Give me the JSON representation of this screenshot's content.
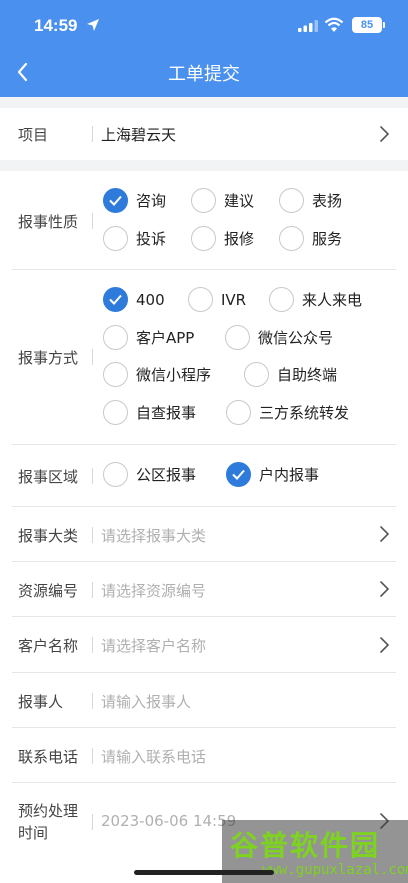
{
  "status_bar": {
    "time": "14:59",
    "battery": "85"
  },
  "nav": {
    "title": "工单提交"
  },
  "project": {
    "label": "项目",
    "value": "上海碧云天"
  },
  "nature": {
    "label": "报事性质",
    "options": [
      {
        "text": "咨询",
        "checked": true
      },
      {
        "text": "建议",
        "checked": false
      },
      {
        "text": "表扬",
        "checked": false
      },
      {
        "text": "投诉",
        "checked": false
      },
      {
        "text": "报修",
        "checked": false
      },
      {
        "text": "服务",
        "checked": false
      }
    ]
  },
  "method": {
    "label": "报事方式",
    "options": [
      {
        "text": "400",
        "checked": true
      },
      {
        "text": "IVR",
        "checked": false
      },
      {
        "text": "来人来电",
        "checked": false
      },
      {
        "text": "客户APP",
        "checked": false
      },
      {
        "text": "微信公众号",
        "checked": false
      },
      {
        "text": "微信小程序",
        "checked": false
      },
      {
        "text": "自助终端",
        "checked": false
      },
      {
        "text": "自查报事",
        "checked": false
      },
      {
        "text": "三方系统转发",
        "checked": false
      }
    ]
  },
  "area": {
    "label": "报事区域",
    "options": [
      {
        "text": "公区报事",
        "checked": false
      },
      {
        "text": "户内报事",
        "checked": true
      }
    ]
  },
  "category": {
    "label": "报事大类",
    "placeholder": "请选择报事大类"
  },
  "resource": {
    "label": "资源编号",
    "placeholder": "请选择资源编号"
  },
  "customer": {
    "label": "客户名称",
    "placeholder": "请选择客户名称"
  },
  "reporter": {
    "label": "报事人",
    "placeholder": "请输入报事人"
  },
  "phone": {
    "label": "联系电话",
    "placeholder": "请输入联系电话"
  },
  "appointment": {
    "label": "预约处理时间",
    "label_line1": "预约处理",
    "label_line2": "时间",
    "value": "2023-06-06 14:59"
  },
  "watermark": {
    "main": "谷普软件园",
    "sub": "www.gupuxlazal.com"
  },
  "colors": {
    "header": "#4a90ee",
    "checked": "#2f7bdc"
  }
}
